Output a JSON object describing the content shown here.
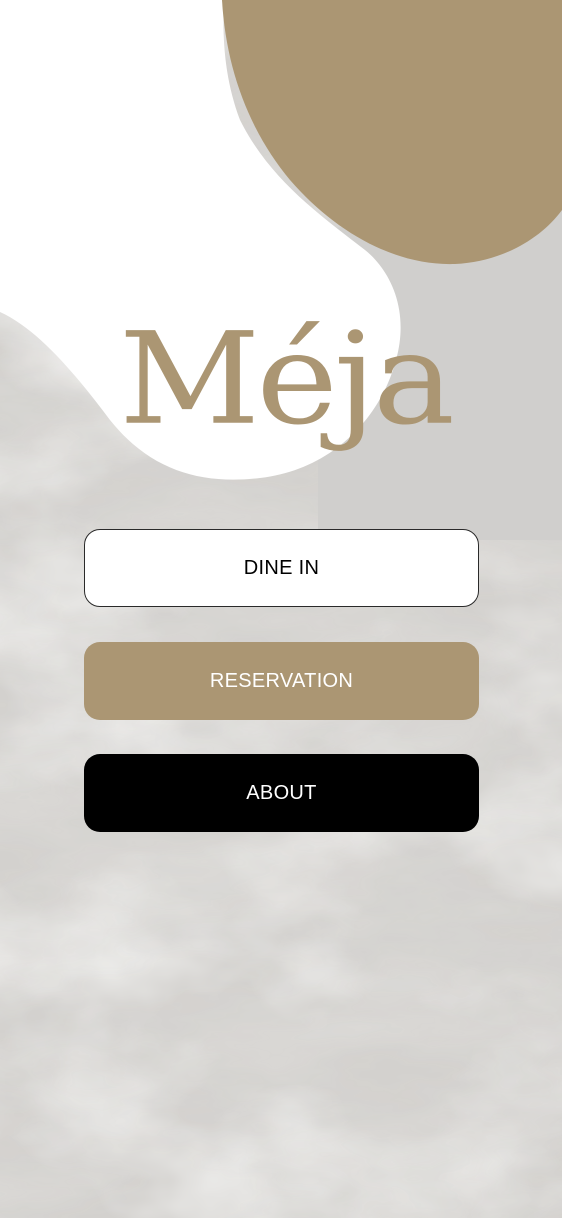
{
  "brand": {
    "name": "Méja",
    "color": "#ab9673"
  },
  "menu": {
    "dine_in": {
      "label": "DINE IN",
      "background": "#ffffff",
      "text_color": "#000000"
    },
    "reservation": {
      "label": "RESERVATION",
      "background": "#ab9673",
      "text_color": "#ffffff"
    },
    "about": {
      "label": "ABOUT",
      "background": "#000000",
      "text_color": "#ffffff"
    }
  },
  "colors": {
    "accent": "#ab9673",
    "marble_base": "#d4d2cf",
    "blob_white": "#ffffff"
  }
}
